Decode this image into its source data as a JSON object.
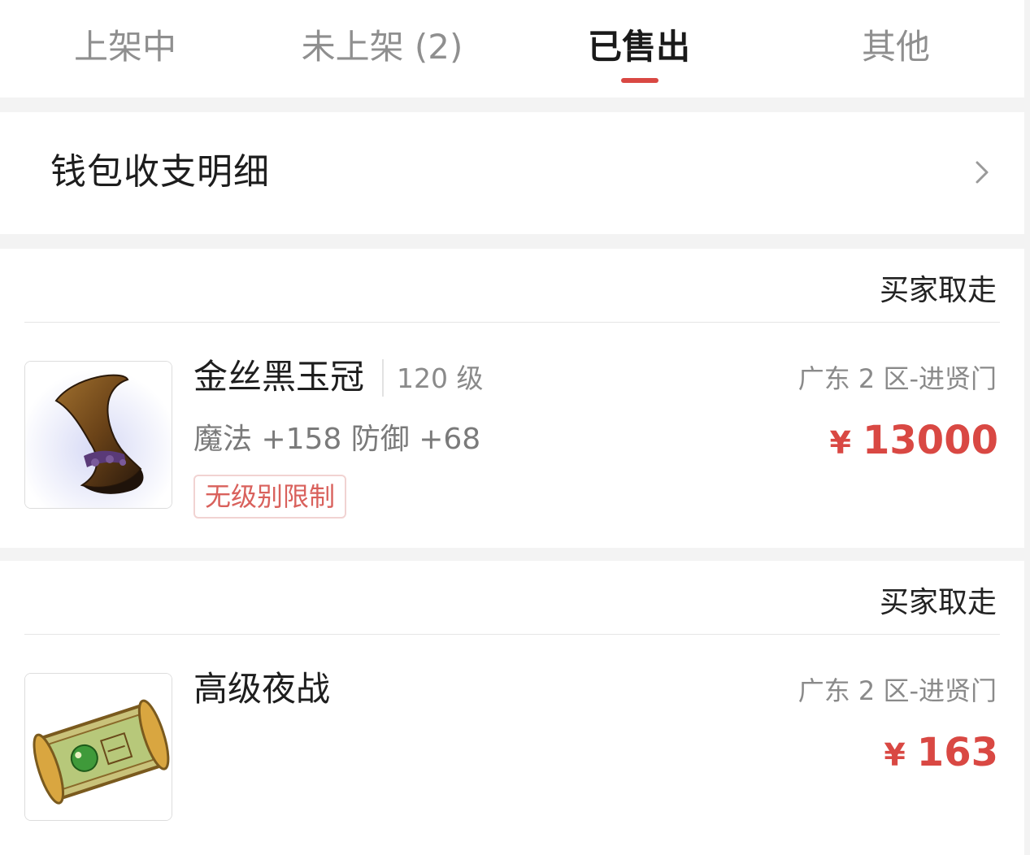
{
  "tabs": [
    {
      "label": "上架中"
    },
    {
      "label": "未上架 (2)"
    },
    {
      "label": "已售出"
    },
    {
      "label": "其他"
    }
  ],
  "active_tab": "已售出",
  "wallet": {
    "label": "钱包收支明细"
  },
  "items": [
    {
      "status": "买家取走",
      "name": "金丝黑玉冠",
      "level": "120 级",
      "stats": "魔法 +158 防御 +68",
      "tag": "无级别限制",
      "server": "广东 2 区-进贤门",
      "currency": "¥",
      "price": "13000",
      "icon": "hat-icon"
    },
    {
      "status": "买家取走",
      "name": "高级夜战",
      "server": "广东 2 区-进贤门",
      "currency": "¥",
      "price": "163",
      "icon": "scroll-icon"
    }
  ],
  "colors": {
    "accent": "#d94843",
    "tag_border": "#f1d3d2",
    "background": "#f3f3f3"
  }
}
